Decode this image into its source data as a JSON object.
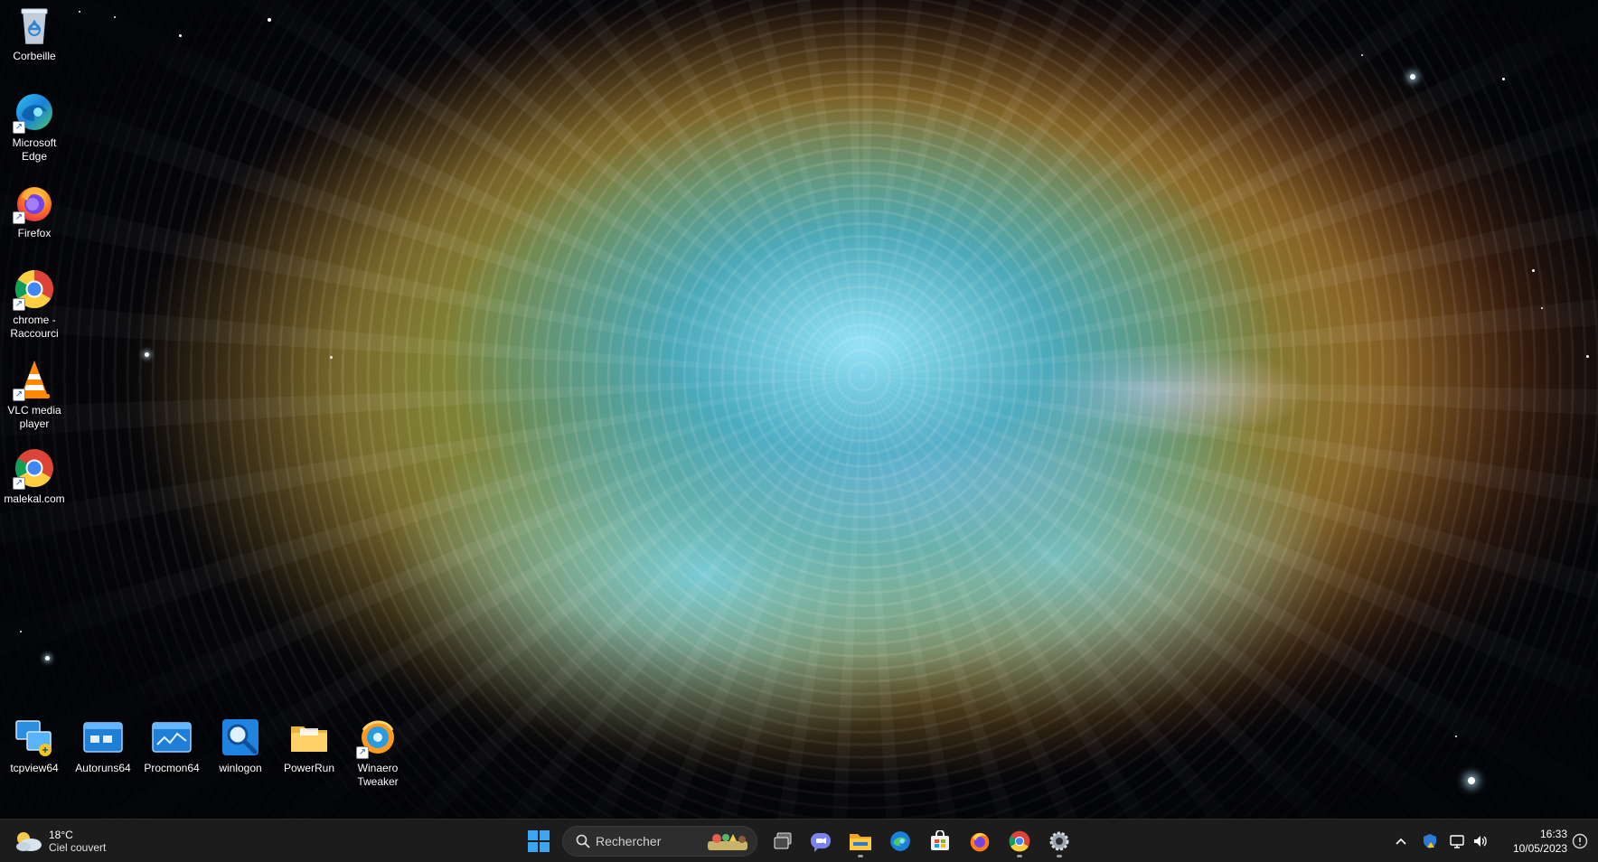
{
  "desktop": {
    "icons_left": [
      {
        "label": "Corbeille",
        "icon": "recycle-bin-icon"
      },
      {
        "label": "Microsoft Edge",
        "icon": "edge-icon"
      },
      {
        "label": "Firefox",
        "icon": "firefox-icon"
      },
      {
        "label": "chrome - Raccourci",
        "icon": "chrome-icon"
      },
      {
        "label": "VLC media player",
        "icon": "vlc-icon"
      },
      {
        "label": "malekal.com",
        "icon": "chrome-icon"
      }
    ],
    "icons_bottom": [
      {
        "label": "tcpview64",
        "icon": "tcpview-icon"
      },
      {
        "label": "Autoruns64",
        "icon": "autoruns-icon"
      },
      {
        "label": "Procmon64",
        "icon": "procmon-icon"
      },
      {
        "label": "winlogon",
        "icon": "magnifier-icon"
      },
      {
        "label": "PowerRun",
        "icon": "folder-icon"
      },
      {
        "label": "Winaero Tweaker",
        "icon": "winaero-icon"
      }
    ]
  },
  "taskbar": {
    "weather": {
      "temp": "18°C",
      "condition": "Ciel couvert"
    },
    "search_placeholder": "Rechercher",
    "pinned": [
      "start-icon",
      "task-view-icon",
      "teams-chat-icon",
      "file-explorer-icon",
      "edge-icon",
      "store-icon",
      "firefox-icon",
      "chrome-icon",
      "settings-icon"
    ],
    "tray": [
      "chevron-up-icon",
      "security-icon",
      "network-icon",
      "volume-icon"
    ],
    "clock": {
      "time": "16:33",
      "date": "10/05/2023"
    }
  },
  "colors": {
    "taskbar": "#1c1c1c",
    "accent": "#0078d4"
  }
}
